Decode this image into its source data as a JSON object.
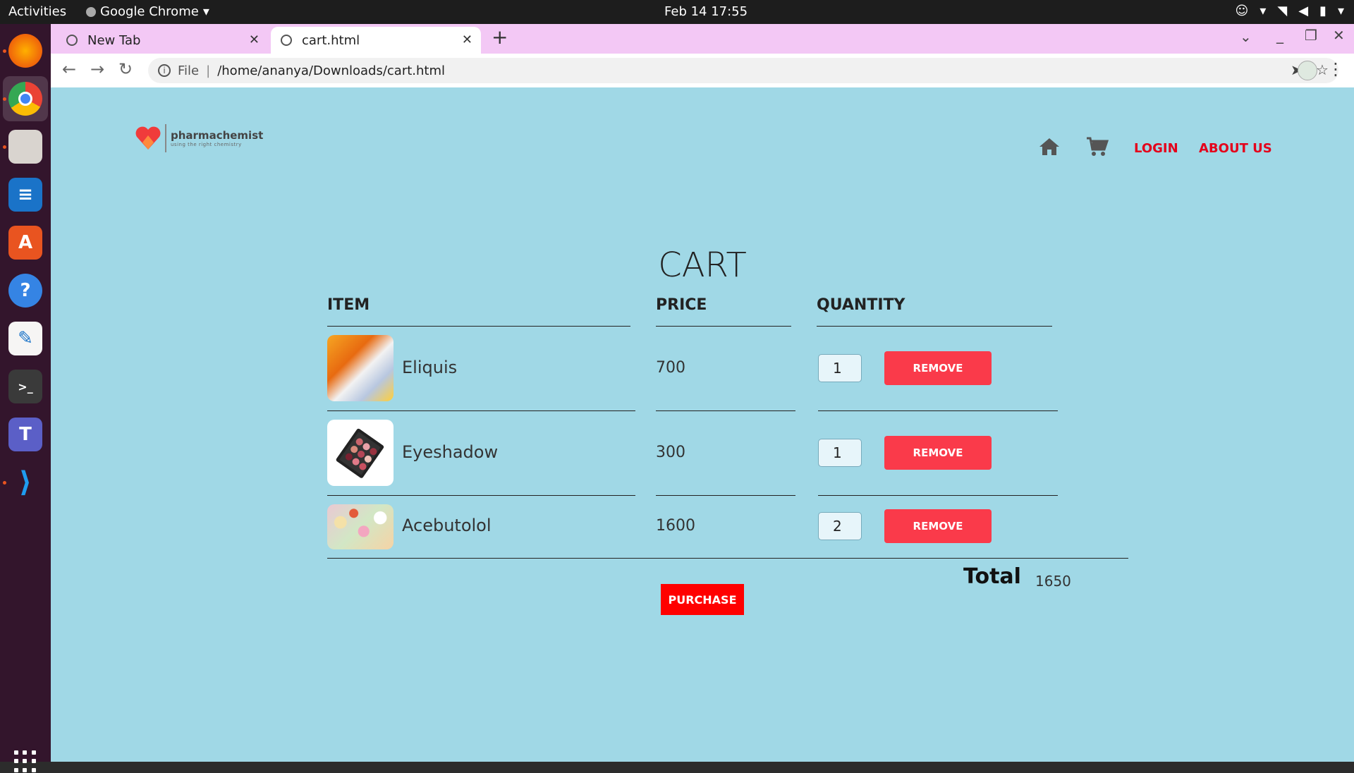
{
  "system": {
    "activities": "Activities",
    "app_name": "Google Chrome",
    "clock": "Feb 14  17:55"
  },
  "browser": {
    "tabs": [
      {
        "title": "New Tab"
      },
      {
        "title": "cart.html"
      }
    ],
    "address_scheme": "File",
    "address_path": "/home/ananya/Downloads/cart.html"
  },
  "site": {
    "brand": "pharmachemist",
    "tagline": "using the right chemistry",
    "nav": {
      "login": "LOGIN",
      "about": "ABOUT US"
    }
  },
  "cart": {
    "title": "CART",
    "headers": {
      "item": "ITEM",
      "price": "PRICE",
      "quantity": "QUANTITY"
    },
    "items": [
      {
        "name": "Eliquis",
        "price": "700",
        "quantity": "1",
        "remove": "REMOVE",
        "image": "pill-bottles-image"
      },
      {
        "name": "Eyeshadow",
        "price": "300",
        "quantity": "1",
        "remove": "REMOVE",
        "image": "eyeshadow-palette-image"
      },
      {
        "name": "Acebutolol",
        "price": "1600",
        "quantity": "2",
        "remove": "REMOVE",
        "image": "assorted-pills-image"
      }
    ],
    "total_label": "Total",
    "total_value": "1650",
    "purchase": "PURCHASE"
  },
  "colors": {
    "page_bg": "#a0d8e6",
    "accent_red": "#e4001b",
    "remove_button": "#fa3a4a",
    "purchase_button": "#ff0000",
    "tab_strip": "#f3c8f5"
  }
}
